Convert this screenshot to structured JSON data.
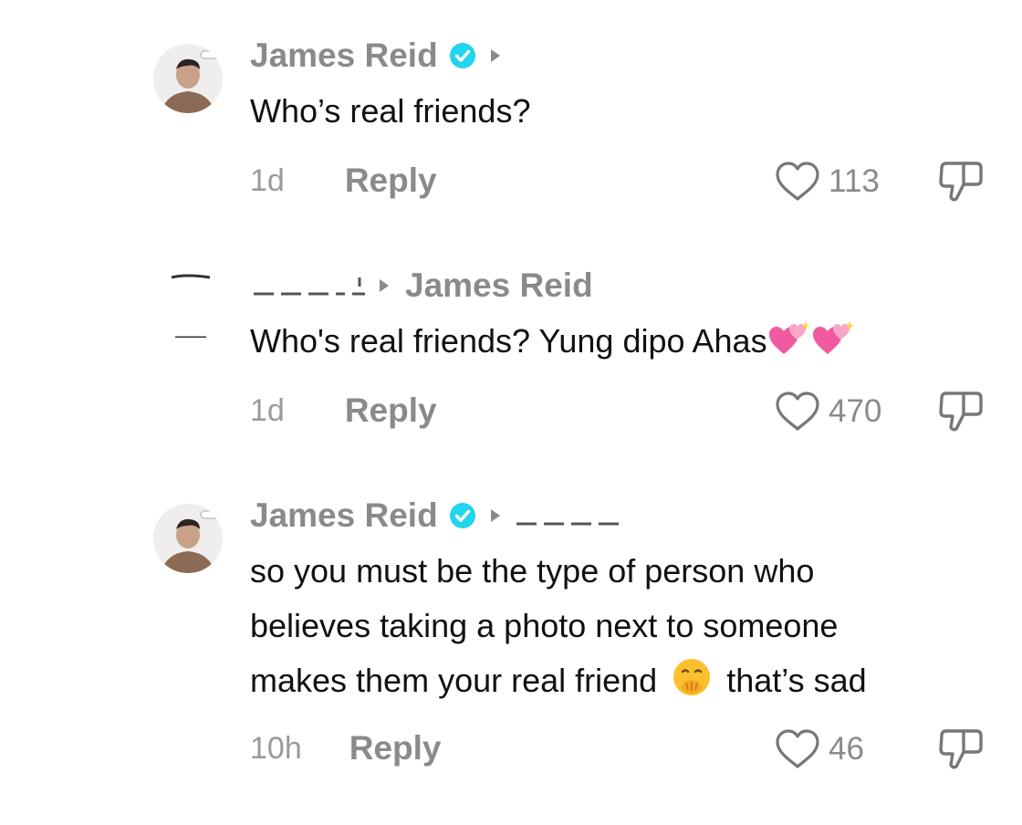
{
  "comments": [
    {
      "author": "James Reid",
      "verified": true,
      "text": "Who’s real friends?",
      "time": "1d",
      "reply_label": "Reply",
      "likes": "113"
    },
    {
      "author": "",
      "reply_to": "James Reid",
      "text": "Who's real friends? Yung dipo Ahas",
      "time": "1d",
      "reply_label": "Reply",
      "likes": "470"
    },
    {
      "author": "James Reid",
      "verified": true,
      "reply_to": "",
      "text_lines": [
        "so you must be the type of person who",
        "believes taking a photo next to someone",
        "makes them your real friend",
        "that’s sad"
      ],
      "time": "10h",
      "reply_label": "Reply",
      "likes": "46"
    }
  ],
  "colors": {
    "verified": "#20D5EC",
    "meta_gray": "#8A8A8A",
    "text": "#111111"
  },
  "icons": [
    "verified-badge-icon",
    "caret-right-icon",
    "heart-icon",
    "thumbs-down-icon",
    "sparkling-heart-emoji",
    "hand-over-mouth-emoji"
  ]
}
